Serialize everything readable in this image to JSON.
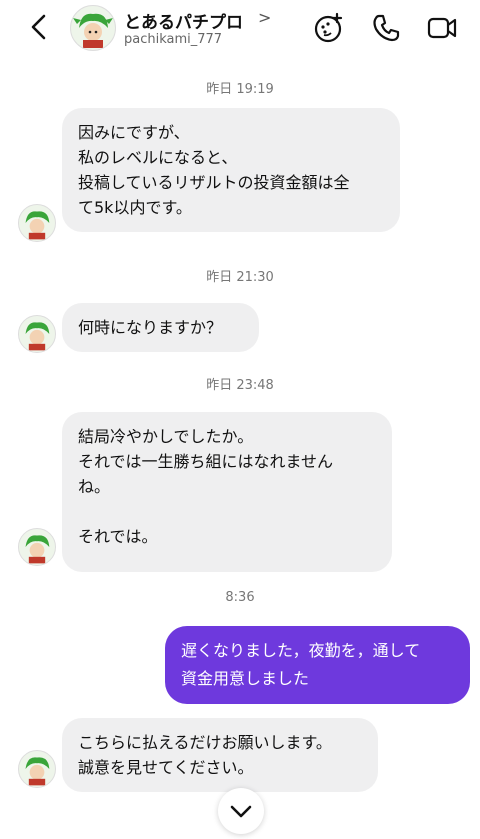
{
  "header": {
    "name": "とあるパチプロ",
    "chevron": ">",
    "username": "pachikami_777",
    "icons": [
      "back-chevron-icon",
      "gamepad-icon",
      "phone-icon",
      "video-icon"
    ]
  },
  "messages": [
    {
      "timestamp": "昨日 19:19",
      "lines": [
        "因みにですが、",
        "私のレベルになると、",
        "投稿しているリザルトの投資金額は全",
        "て5k以内です。"
      ]
    },
    {
      "timestamp": "昨日 21:30",
      "lines": [
        "何時になりますか？"
      ]
    },
    {
      "timestamp": "昨日 23:48",
      "lines": [
        "結局冷やかしでしたか。",
        "それでは一生勝ち組にはなれません",
        "ね。",
        "",
        "それでは。"
      ]
    },
    {
      "timestamp": "8:36",
      "lines": [
        "遅くなりました，夜勤を，通して",
        "資金用意しました"
      ]
    },
    {
      "lines": [
        "こちらに払えるだけお願いします。",
        "誠意を見せてください。"
      ]
    }
  ],
  "colors": {
    "outgoing": "#6e39dd",
    "incoming": "#efeff0"
  }
}
